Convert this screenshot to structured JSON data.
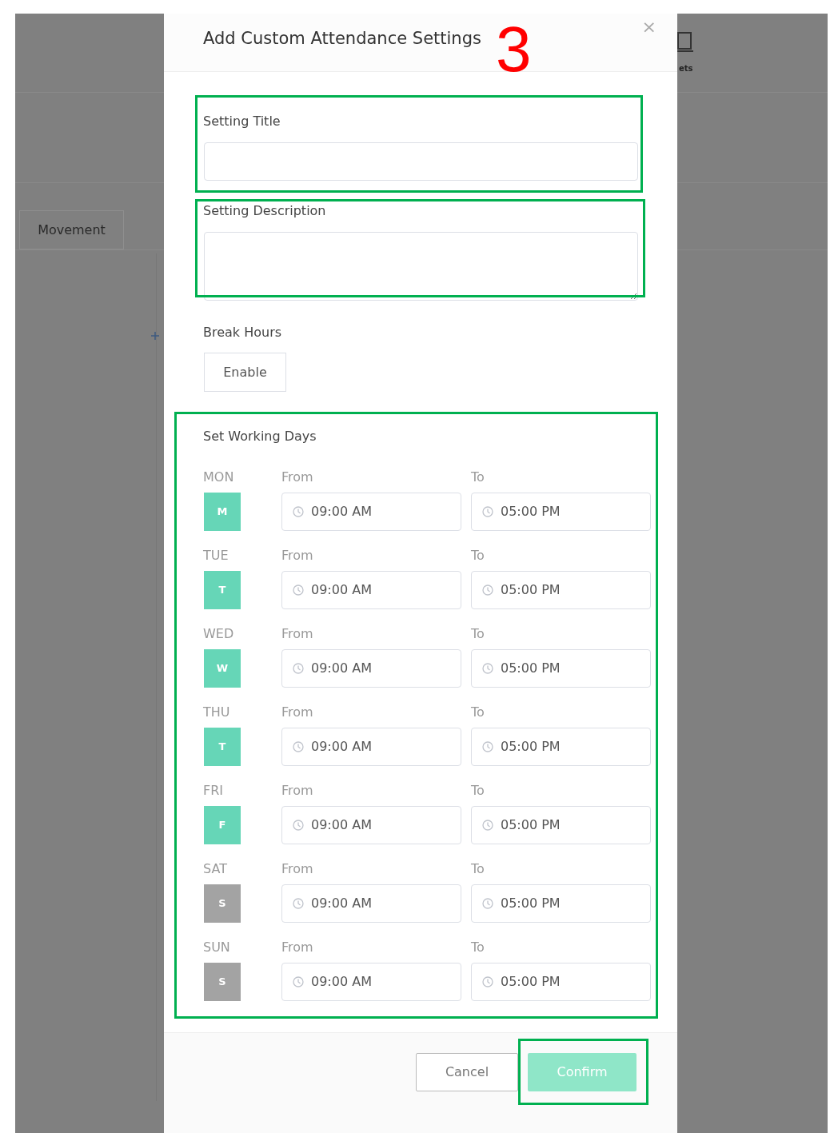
{
  "background": {
    "tab": "Movement",
    "toolbar_label": "ets"
  },
  "dialog": {
    "title": "Add Custom Attendance Settings",
    "close": "×",
    "fields": [
      {
        "kind": "input",
        "label": "Setting Title"
      },
      {
        "kind": "textarea",
        "label": "Setting Description"
      }
    ],
    "break_hours": {
      "label": "Break Hours",
      "button": "Enable"
    },
    "working_days": {
      "label": "Set Working Days",
      "days": [
        {
          "name": "MON",
          "letter": "M",
          "selected": true,
          "from_label": "From",
          "from": "09:00 AM",
          "to_label": "To",
          "to": "05:00 PM"
        },
        {
          "name": "TUE",
          "letter": "T",
          "selected": true,
          "from_label": "From",
          "from": "09:00 AM",
          "to_label": "To",
          "to": "05:00 PM"
        },
        {
          "name": "WED",
          "letter": "W",
          "selected": true,
          "from_label": "From",
          "from": "09:00 AM",
          "to_label": "To",
          "to": "05:00 PM"
        },
        {
          "name": "THU",
          "letter": "T",
          "selected": true,
          "from_label": "From",
          "from": "09:00 AM",
          "to_label": "To",
          "to": "05:00 PM"
        },
        {
          "name": "FRI",
          "letter": "F",
          "selected": true,
          "from_label": "From",
          "from": "09:00 AM",
          "to_label": "To",
          "to": "05:00 PM"
        },
        {
          "name": "SAT",
          "letter": "S",
          "selected": false,
          "from_label": "From",
          "from": "09:00 AM",
          "to_label": "To",
          "to": "05:00 PM"
        },
        {
          "name": "SUN",
          "letter": "S",
          "selected": false,
          "from_label": "From",
          "from": "09:00 AM",
          "to_label": "To",
          "to": "05:00 PM"
        }
      ]
    },
    "buttons": {
      "cancel": "Cancel",
      "confirm": "Confirm"
    }
  },
  "annotation": {
    "step": "3"
  }
}
